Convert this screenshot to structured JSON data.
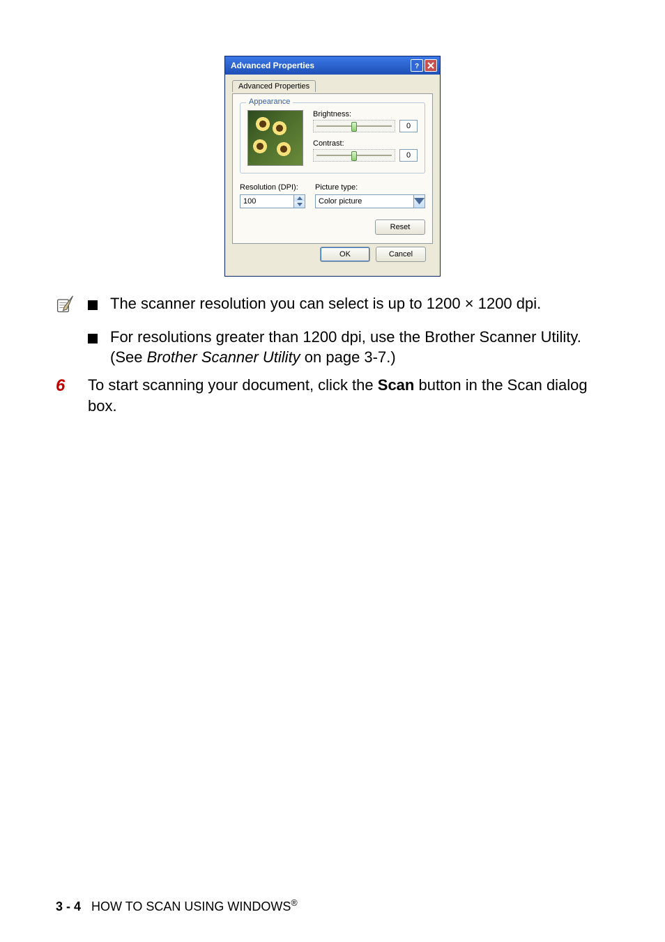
{
  "dialog": {
    "title": "Advanced Properties",
    "tab_label": "Advanced Properties",
    "appearance_legend": "Appearance",
    "brightness_label": "Brightness:",
    "brightness_value": "0",
    "contrast_label": "Contrast:",
    "contrast_value": "0",
    "resolution_label": "Resolution (DPI):",
    "resolution_value": "100",
    "picture_type_label": "Picture type:",
    "picture_type_value": "Color picture",
    "reset_label": "Reset",
    "ok_label": "OK",
    "cancel_label": "Cancel"
  },
  "notes": {
    "line1a": "The scanner resolution you can select is up to 1200 ",
    "line1_mult": "×",
    "line1b": " 1200 dpi.",
    "line2a": "For resolutions greater than 1200 dpi, use the Brother Scanner Utility. (See ",
    "line2_ref": "Brother Scanner Utility",
    "line2b": " on page 3-7.)"
  },
  "step": {
    "num": "6",
    "text_a": "To start scanning your document, click the ",
    "text_bold": "Scan",
    "text_b": " button in the Scan dialog box."
  },
  "footer": {
    "page": "3 - 4",
    "title": "HOW TO SCAN USING WINDOWS",
    "sup": "®"
  }
}
